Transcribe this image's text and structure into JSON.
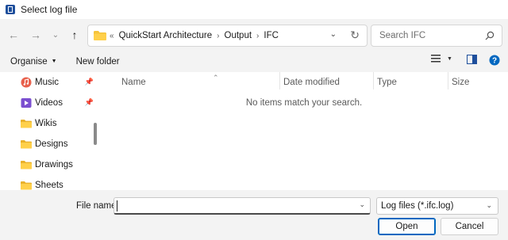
{
  "window": {
    "title": "Select log file"
  },
  "nav": {
    "back_icon": "arrow-left-icon",
    "forward_icon": "arrow-right-icon",
    "recent_icon": "chevron-down-icon",
    "up_icon": "arrow-up-icon"
  },
  "address": {
    "overflow": "«",
    "crumbs": [
      "QuickStart Architecture",
      "Output",
      "IFC"
    ],
    "separator": "›"
  },
  "search": {
    "placeholder": "Search IFC"
  },
  "commands": {
    "organise": "Organise",
    "new_folder": "New folder"
  },
  "sidebar": {
    "items": [
      {
        "label": "Music",
        "icon": "music-icon",
        "pinned": true
      },
      {
        "label": "Videos",
        "icon": "videos-icon",
        "pinned": true
      },
      {
        "label": "Wikis",
        "icon": "folder-icon",
        "pinned": false
      },
      {
        "label": "Designs",
        "icon": "folder-icon",
        "pinned": false
      },
      {
        "label": "Drawings",
        "icon": "folder-icon",
        "pinned": false
      },
      {
        "label": "Sheets",
        "icon": "folder-icon",
        "pinned": false
      }
    ]
  },
  "columns": [
    "Name",
    "Date modified",
    "Type",
    "Size"
  ],
  "file_list": {
    "empty_message": "No items match your search."
  },
  "footer": {
    "file_name_label": "File name:",
    "file_name_value": "",
    "filter_value": "Log files (*.ifc.log)",
    "open_label": "Open",
    "cancel_label": "Cancel"
  },
  "colors": {
    "folder": "#f5c33b",
    "accent": "#0067c0",
    "music": "#e8604c",
    "videos": "#7b4fd0"
  }
}
